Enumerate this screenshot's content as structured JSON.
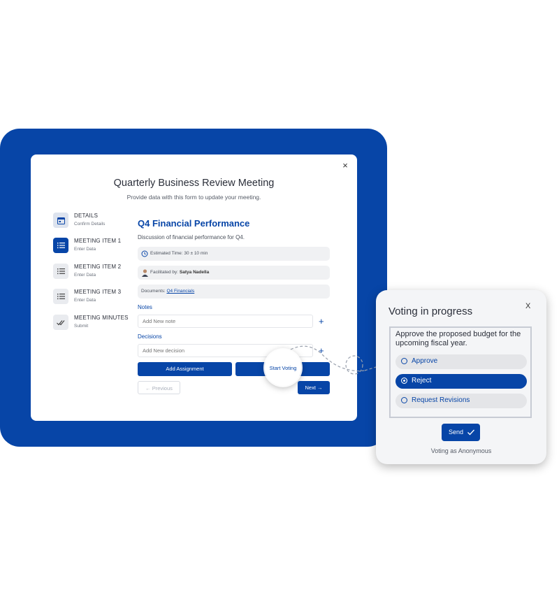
{
  "modal": {
    "title": "Quarterly Business Review Meeting",
    "subtitle": "Provide data with this form to update your meeting.",
    "close": "×"
  },
  "steps": [
    {
      "title": "DETAILS",
      "sub": "Confirm Details",
      "icon": "calendar-icon"
    },
    {
      "title": "MEETING ITEM 1",
      "sub": "Enter Data",
      "icon": "list-icon"
    },
    {
      "title": "MEETING ITEM 2",
      "sub": "Enter Data",
      "icon": "list-icon"
    },
    {
      "title": "MEETING ITEM 3",
      "sub": "Enter Data",
      "icon": "list-icon"
    },
    {
      "title": "MEETING MINUTES",
      "sub": "Submit",
      "icon": "double-check-icon"
    }
  ],
  "item": {
    "heading": "Q4 Financial Performance",
    "description": "Discussion of financial performance for Q4.",
    "estimated_time": "Estimated Time: 30 ± 10 min",
    "facilitated_label": "Facilitated by:",
    "facilitator": "Satya Nadella",
    "documents_label": "Documents:",
    "documents_link": "Q4 Financials"
  },
  "notes": {
    "label": "Notes",
    "placeholder": "Add New note"
  },
  "decisions": {
    "label": "Decisions",
    "placeholder": "Add New decision"
  },
  "buttons": {
    "add_assignment": "Add Assignment",
    "start_voting": "Start Voting",
    "previous": "← Previous",
    "next": "Next →"
  },
  "voting": {
    "title": "Voting in progress",
    "close": "X",
    "question": "Approve the proposed budget for the upcoming fiscal year.",
    "options": [
      "Approve",
      "Reject",
      "Request Revisions"
    ],
    "selected": "Reject",
    "send": "Send",
    "footer": "Voting as Anonymous"
  },
  "colors": {
    "primary": "#0745a7",
    "pill": "#f0f1f3",
    "card": "#f4f5f7"
  }
}
